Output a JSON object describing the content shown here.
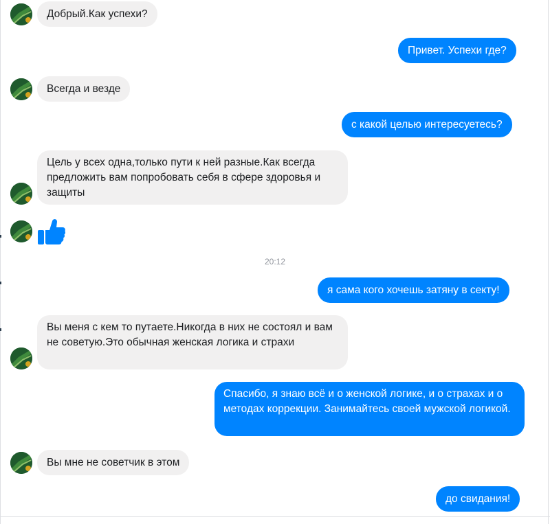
{
  "colors": {
    "outgoing_bubble": "#0084ff",
    "incoming_bubble": "#f1f0f0",
    "timestamp": "#90949c"
  },
  "messages": [
    {
      "from": "them",
      "text": "Добрый.Как успехи?"
    },
    {
      "from": "me",
      "text": "Привет. Успехи где?"
    },
    {
      "from": "them",
      "text": "Всегда и везде"
    },
    {
      "from": "me",
      "text": "с какой целью интересуетесь?"
    },
    {
      "from": "them",
      "text": "Цель у всех одна,только пути к ней разные.Как всегда предложить вам попробовать себя в сфере здоровья и защиты"
    },
    {
      "from": "them",
      "type": "like",
      "icon": "thumbs-up-icon"
    },
    {
      "from": "me",
      "text": "я сама кого хочешь затяну в секту!"
    },
    {
      "from": "them",
      "text": "Вы меня с кем то путаете.Никогда в них не состоял и вам не советую.Это обычная женская логика и страхи"
    },
    {
      "from": "me",
      "text": "Спасибо, я знаю всё и о женской логике, и о страхах и о методах коррекции. Занимайтесь своей мужской логикой."
    },
    {
      "from": "them",
      "text": "Вы мне не советчик в этом"
    },
    {
      "from": "me",
      "text": "до свидания!"
    }
  ],
  "divider": {
    "time": "20:12"
  },
  "avatar_icon": "contact-avatar-icon"
}
